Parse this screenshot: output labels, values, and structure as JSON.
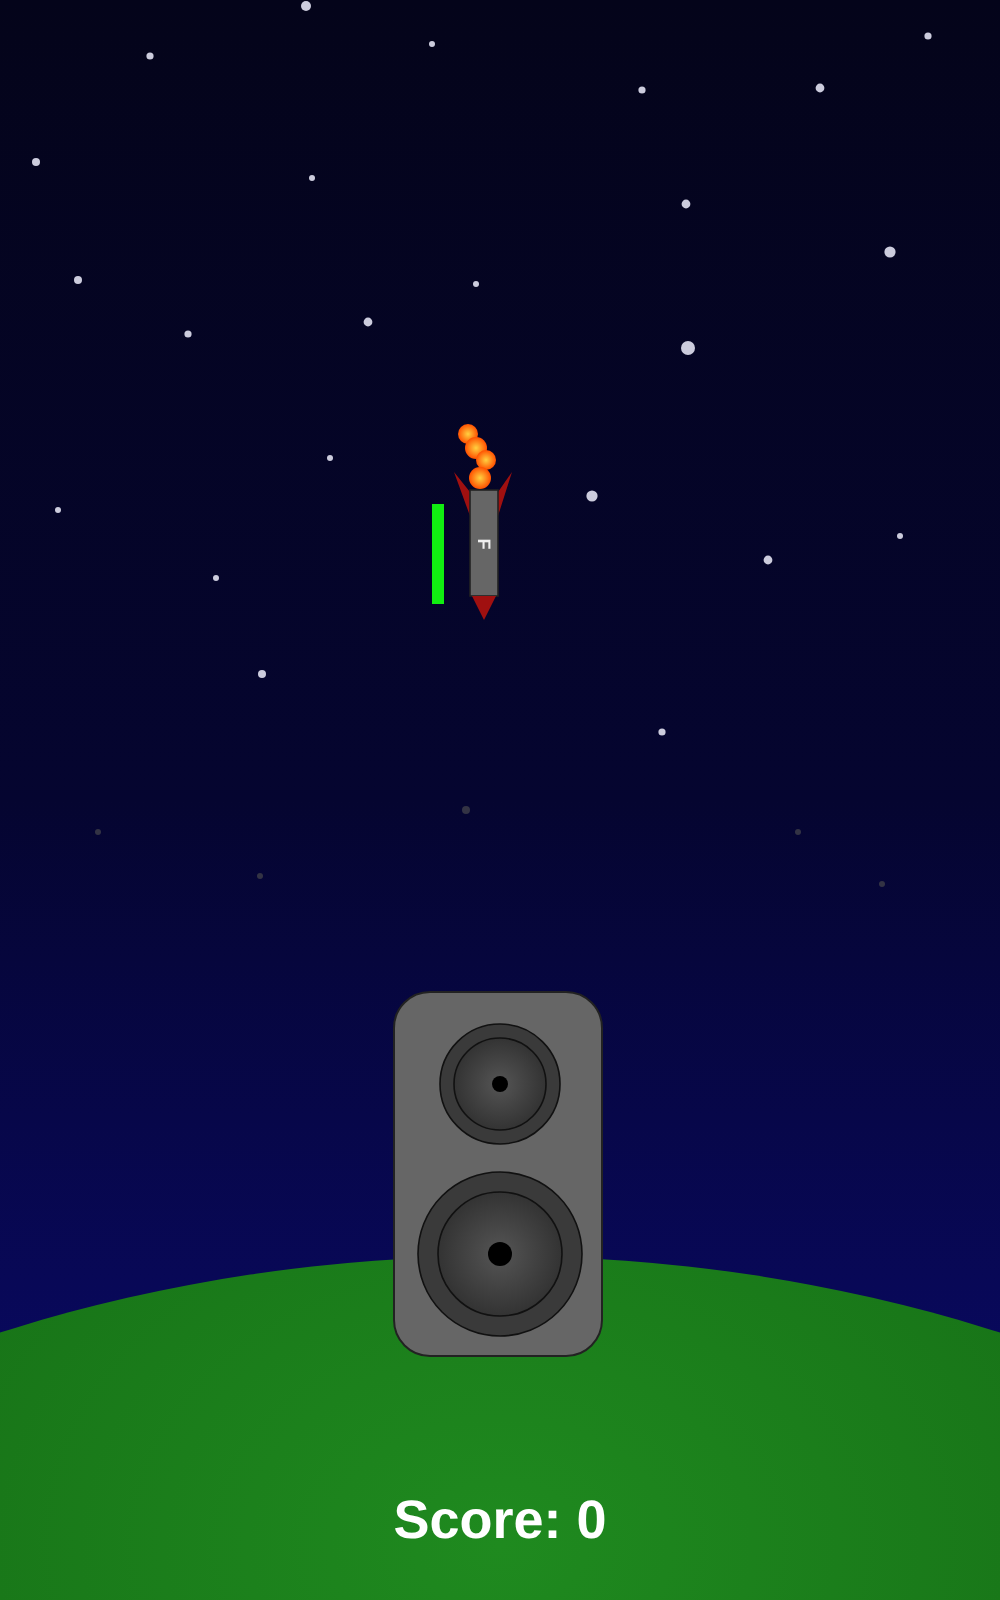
{
  "rocket": {
    "letter": "F",
    "health": {
      "level": 1
    }
  },
  "score": "Score: 0"
}
